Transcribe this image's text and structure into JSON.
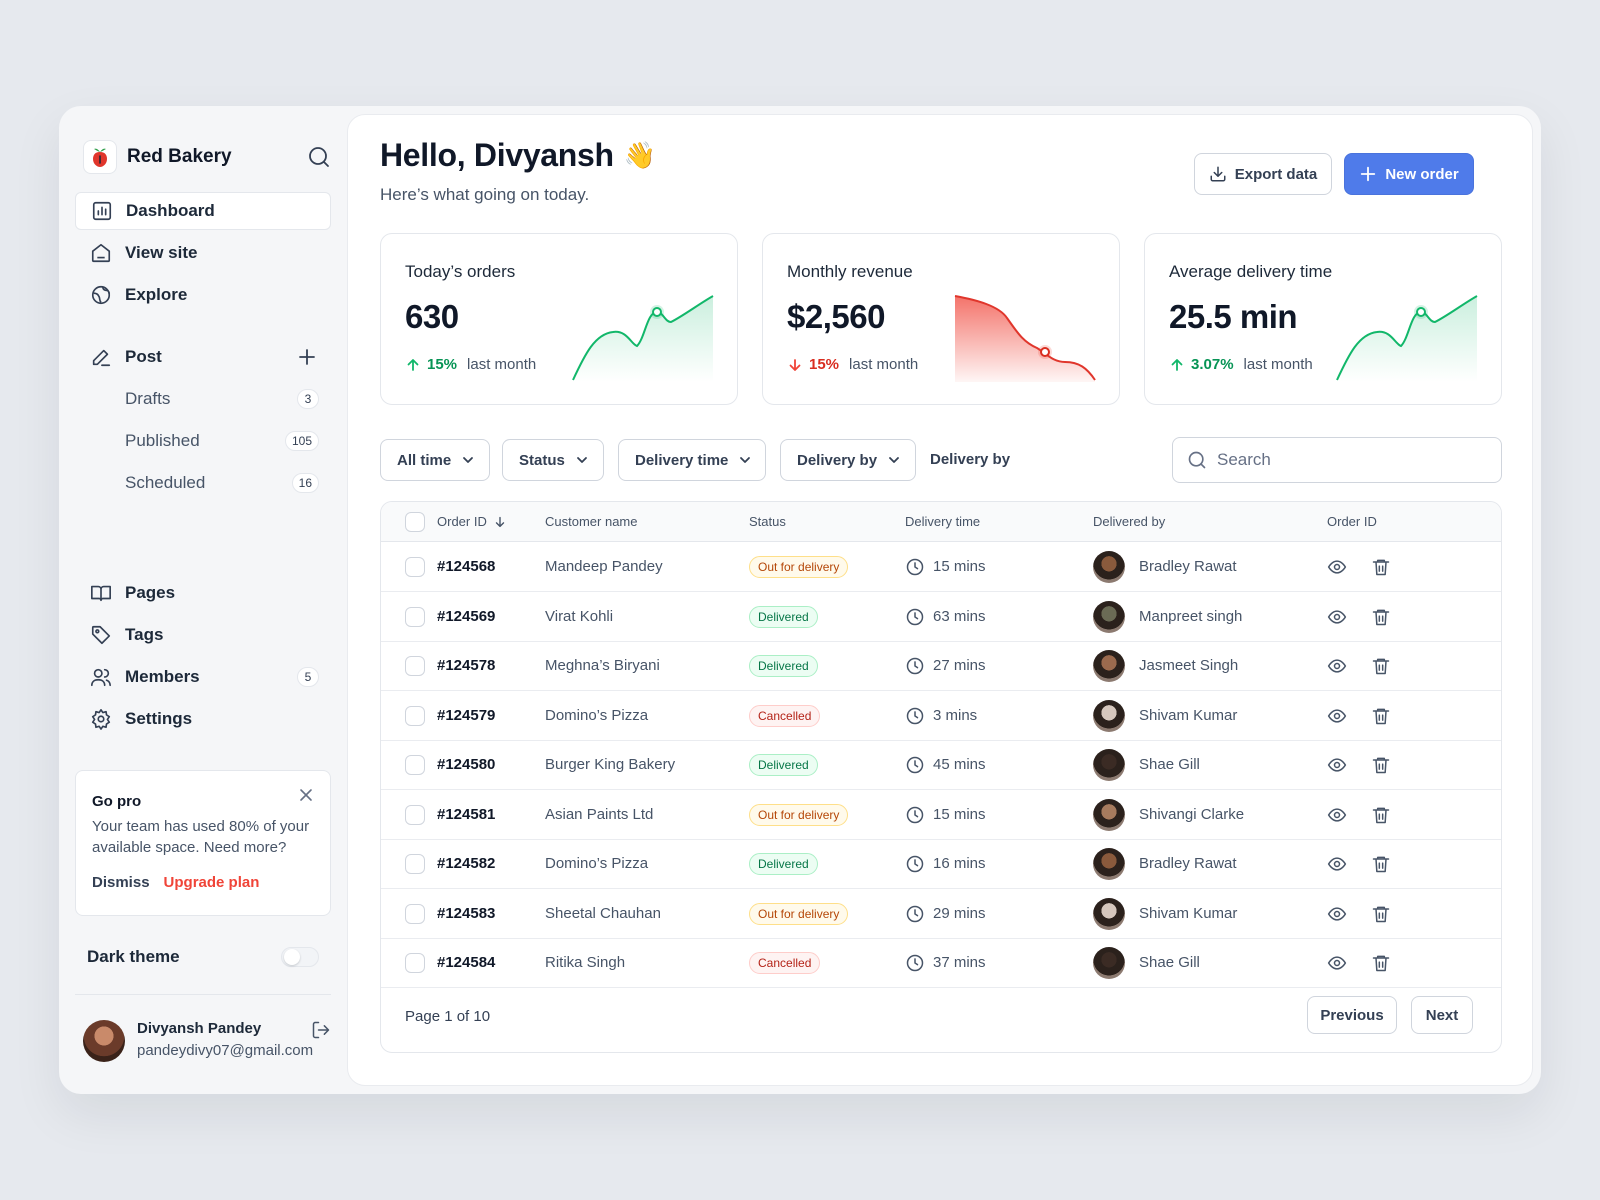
{
  "brand": {
    "name": "Red Bakery"
  },
  "sidebar": {
    "nav": [
      {
        "label": "Dashboard",
        "icon": "bar-chart-icon",
        "active": true
      },
      {
        "label": "View site",
        "icon": "home-icon"
      },
      {
        "label": "Explore",
        "icon": "globe-icon"
      }
    ],
    "post": {
      "label": "Post",
      "icon": "pencil-icon"
    },
    "post_items": [
      {
        "label": "Drafts",
        "count": "3"
      },
      {
        "label": "Published",
        "count": "105"
      },
      {
        "label": "Scheduled",
        "count": "16"
      }
    ],
    "lower_nav": [
      {
        "label": "Pages",
        "icon": "book-icon"
      },
      {
        "label": "Tags",
        "icon": "tag-icon"
      },
      {
        "label": "Members",
        "icon": "users-icon",
        "count": "5"
      },
      {
        "label": "Settings",
        "icon": "gear-icon"
      }
    ],
    "promo": {
      "title": "Go pro",
      "text": "Your team has used 80% of your available space. Need more?",
      "dismiss": "Dismiss",
      "upgrade": "Upgrade plan"
    },
    "dark_theme": {
      "label": "Dark theme",
      "enabled": false
    },
    "user": {
      "name": "Divyansh Pandey",
      "email": "pandeydivy07@gmail.com"
    }
  },
  "header": {
    "greeting": "Hello, Divyansh",
    "wave": "👋",
    "subtitle": "Here’s what going on today.",
    "export_label": "Export data",
    "new_order_label": "New order"
  },
  "stats": [
    {
      "title": "Today’s orders",
      "value": "630",
      "trend": "15%",
      "direction": "up",
      "trend_label": "last month",
      "color": "#12b76a"
    },
    {
      "title": "Monthly revenue",
      "value": "$2,560",
      "trend": "15%",
      "direction": "down",
      "trend_label": "last month",
      "color": "#f04438"
    },
    {
      "title": "Average delivery time",
      "value": "25.5 min",
      "trend": "3.07%",
      "direction": "up",
      "trend_label": "last month",
      "color": "#12b76a"
    }
  ],
  "filters": {
    "all_time": "All time",
    "status": "Status",
    "delivery_time": "Delivery time",
    "delivery_by": "Delivery by",
    "delivery_by_plain": "Delivery by",
    "search_placeholder": "Search"
  },
  "table": {
    "columns": {
      "order_id": "Order ID",
      "customer": "Customer name",
      "status": "Status",
      "delivery_time": "Delivery time",
      "delivered_by": "Delivered by",
      "actions": "Order ID"
    },
    "rows": [
      {
        "id": "#124568",
        "customer": "Mandeep Pandey",
        "status": "Out for delivery",
        "kind": "out",
        "time": "15 mins",
        "by": "Bradley Rawat",
        "avatar": "#8a5a3c"
      },
      {
        "id": "#124569",
        "customer": "Virat Kohli",
        "status": "Delivered",
        "kind": "del",
        "time": "63 mins",
        "by": "Manpreet singh",
        "avatar": "#6b6b55"
      },
      {
        "id": "#124578",
        "customer": "Meghna’s Biryani",
        "status": "Delivered",
        "kind": "del",
        "time": "27 mins",
        "by": "Jasmeet Singh",
        "avatar": "#9b6a4e"
      },
      {
        "id": "#124579",
        "customer": "Domino’s Pizza",
        "status": "Cancelled",
        "kind": "can",
        "time": "3 mins",
        "by": "Shivam Kumar",
        "avatar": "#d6c7bd"
      },
      {
        "id": "#124580",
        "customer": "Burger King Bakery",
        "status": "Delivered",
        "kind": "del",
        "time": "45 mins",
        "by": "Shae Gill",
        "avatar": "#3b2b24"
      },
      {
        "id": "#124581",
        "customer": "Asian Paints Ltd",
        "status": "Out for delivery",
        "kind": "out",
        "time": "15 mins",
        "by": "Shivangi Clarke",
        "avatar": "#a77b5e"
      },
      {
        "id": "#124582",
        "customer": "Domino’s Pizza",
        "status": "Delivered",
        "kind": "del",
        "time": "16 mins",
        "by": "Bradley Rawat",
        "avatar": "#8a5a3c"
      },
      {
        "id": "#124583",
        "customer": "Sheetal Chauhan",
        "status": "Out for delivery",
        "kind": "out",
        "time": "29 mins",
        "by": "Shivam Kumar",
        "avatar": "#d6c7bd"
      },
      {
        "id": "#124584",
        "customer": "Ritika Singh",
        "status": "Cancelled",
        "kind": "can",
        "time": "37 mins",
        "by": "Shae Gill",
        "avatar": "#3b2b24"
      }
    ],
    "page_info": "Page 1 of 10",
    "previous": "Previous",
    "next": "Next"
  }
}
